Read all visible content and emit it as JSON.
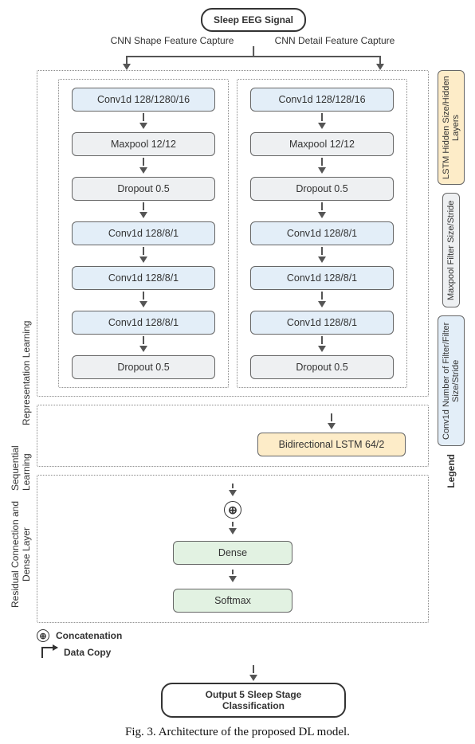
{
  "input_label": "Sleep EEG Signal",
  "top_left_label": "CNN Shape Feature Capture",
  "top_right_label": "CNN Detail Feature Capture",
  "side": {
    "rep": "Representation Learning",
    "seq": "Sequential Learning",
    "res": "Residual Connection and Dense Layer"
  },
  "left_col": {
    "layers": [
      {
        "type": "conv",
        "text": "Conv1d 128/1280/16"
      },
      {
        "type": "pool",
        "text": "Maxpool 12/12"
      },
      {
        "type": "drop",
        "text": "Dropout 0.5"
      },
      {
        "type": "conv",
        "text": "Conv1d 128/8/1"
      },
      {
        "type": "conv",
        "text": "Conv1d 128/8/1"
      },
      {
        "type": "conv",
        "text": "Conv1d 128/8/1"
      },
      {
        "type": "drop",
        "text": "Dropout 0.5"
      }
    ]
  },
  "right_col": {
    "layers": [
      {
        "type": "conv",
        "text": "Conv1d 128/128/16"
      },
      {
        "type": "pool",
        "text": "Maxpool 12/12"
      },
      {
        "type": "drop",
        "text": "Dropout 0.5"
      },
      {
        "type": "conv",
        "text": "Conv1d 128/8/1"
      },
      {
        "type": "conv",
        "text": "Conv1d 128/8/1"
      },
      {
        "type": "conv",
        "text": "Conv1d 128/8/1"
      },
      {
        "type": "drop",
        "text": "Dropout 0.5"
      }
    ]
  },
  "lstm_text": "Bidirectional LSTM 64/2",
  "dense_text": "Dense",
  "softmax_text": "Softmax",
  "output_label": "Output 5 Sleep Stage Classification",
  "footnotes": {
    "concat": "Concatenation",
    "datacopy": "Data Copy"
  },
  "legend": {
    "title": "Legend",
    "lstm": "LSTM Hidden Size/Hidden Layers",
    "maxpool": "Maxpool  Filter Size/Stride",
    "conv": "Conv1d Number of Filter/Filter Size/Stride"
  },
  "caption": "Fig. 3.   Architecture of the proposed DL model."
}
